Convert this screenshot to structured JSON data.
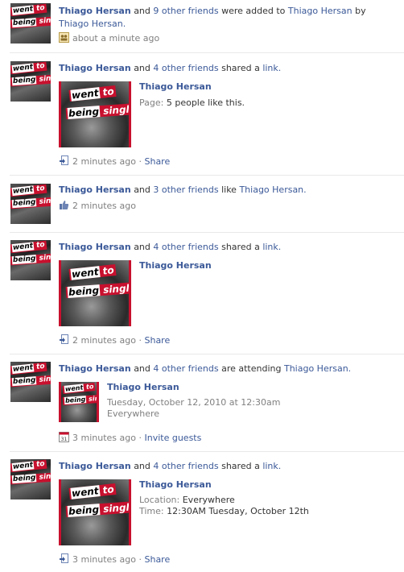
{
  "stories": [
    {
      "actor": "Thiago Hersan",
      "others": "9 other friends",
      "verb": "were added to",
      "target": "Thiago Hersan",
      "by_word": "by",
      "by_actor": "Thiago Hersan.",
      "time": "about a minute ago",
      "icon": "friends-icon"
    },
    {
      "actor": "Thiago Hersan",
      "others": "4 other friends",
      "verb": "shared a",
      "object": "link.",
      "time": "2 minutes ago",
      "action": "Share",
      "icon": "link-icon",
      "attachment": {
        "title": "Thiago Hersan",
        "label": "Page:",
        "value": "5 people like this."
      }
    },
    {
      "actor": "Thiago Hersan",
      "others": "3 other friends",
      "verb": "like",
      "target": "Thiago Hersan.",
      "time": "2 minutes ago",
      "icon": "like-icon"
    },
    {
      "actor": "Thiago Hersan",
      "others": "4 other friends",
      "verb": "shared a",
      "object": "link.",
      "time": "2 minutes ago",
      "action": "Share",
      "icon": "link-icon",
      "attachment": {
        "title": "Thiago Hersan"
      }
    },
    {
      "actor": "Thiago Hersan",
      "others": "4 other friends",
      "verb": "are attending",
      "target": "Thiago Hersan.",
      "time": "3 minutes ago",
      "action": "Invite guests",
      "icon": "calendar-icon",
      "calendar_day": "31",
      "attachment": {
        "title": "Thiago Hersan",
        "when": "Tuesday, October 12, 2010 at 12:30am",
        "where": "Everywhere"
      }
    },
    {
      "actor": "Thiago Hersan",
      "others": "4 other friends",
      "verb": "shared a",
      "object": "link.",
      "time": "3 minutes ago",
      "action": "Share",
      "icon": "link-icon",
      "attachment": {
        "title": "Thiago Hersan",
        "location_label": "Location:",
        "location": "Everywhere",
        "time_label": "Time:",
        "time": "12:30AM Tuesday, October 12th"
      }
    }
  ],
  "word_and": "and",
  "separator": "·",
  "image_text": {
    "top": "went",
    "top2": "to",
    "bottom": "being",
    "bottom2": "single"
  },
  "colors": {
    "link": "#3b5998",
    "muted": "#808080",
    "band": "#c8102e"
  }
}
